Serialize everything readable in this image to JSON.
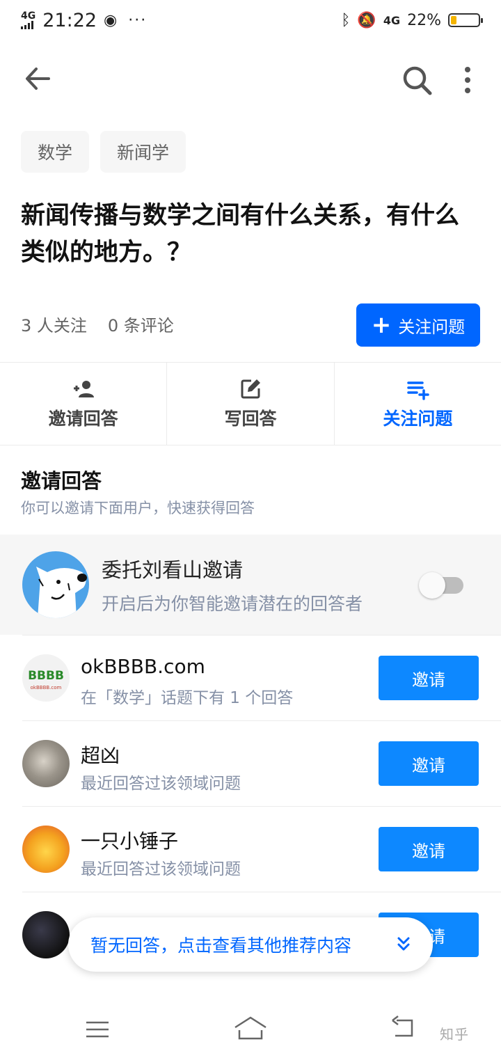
{
  "status_bar": {
    "network": "4G",
    "time": "21:22",
    "network_right": "4G",
    "battery_percent": "22%",
    "battery_level": 0.22,
    "dots": "···"
  },
  "topics": [
    "数学",
    "新闻学"
  ],
  "question": {
    "title": "新闻传播与数学之间有什么关系，有什么类似的地方。？",
    "followers": "3 人关注",
    "comments": "0 条评论",
    "follow_button": "关注问题"
  },
  "actions": [
    {
      "label": "邀请回答",
      "icon": "add-person-icon"
    },
    {
      "label": "写回答",
      "icon": "edit-icon"
    },
    {
      "label": "关注问题",
      "icon": "playlist-add-icon"
    }
  ],
  "invite_section": {
    "heading": "邀请回答",
    "subtitle": "你可以邀请下面用户，快速获得回答",
    "delegate_name": "委托刘看山邀请",
    "delegate_desc": "开启后为你智能邀请潜在的回答者",
    "delegate_enabled": false
  },
  "users": [
    {
      "name": "okBBBB.com",
      "desc": "在「数学」话题下有 1 个回答",
      "button": "邀请",
      "avatar_text": "BBBB",
      "avatar_caption": "okBBBB.com"
    },
    {
      "name": "超凶",
      "desc": "最近回答过该领域问题",
      "button": "邀请"
    },
    {
      "name": "一只小锤子",
      "desc": "最近回答过该领域问题",
      "button": "邀请"
    },
    {
      "name": "",
      "desc": "",
      "button": "邀请"
    }
  ],
  "toast": "暂无回答，点击查看其他推荐内容",
  "watermark": "知乎",
  "colors": {
    "primary": "#0066ff",
    "invite": "#0d88ff",
    "muted": "#8590a6"
  }
}
